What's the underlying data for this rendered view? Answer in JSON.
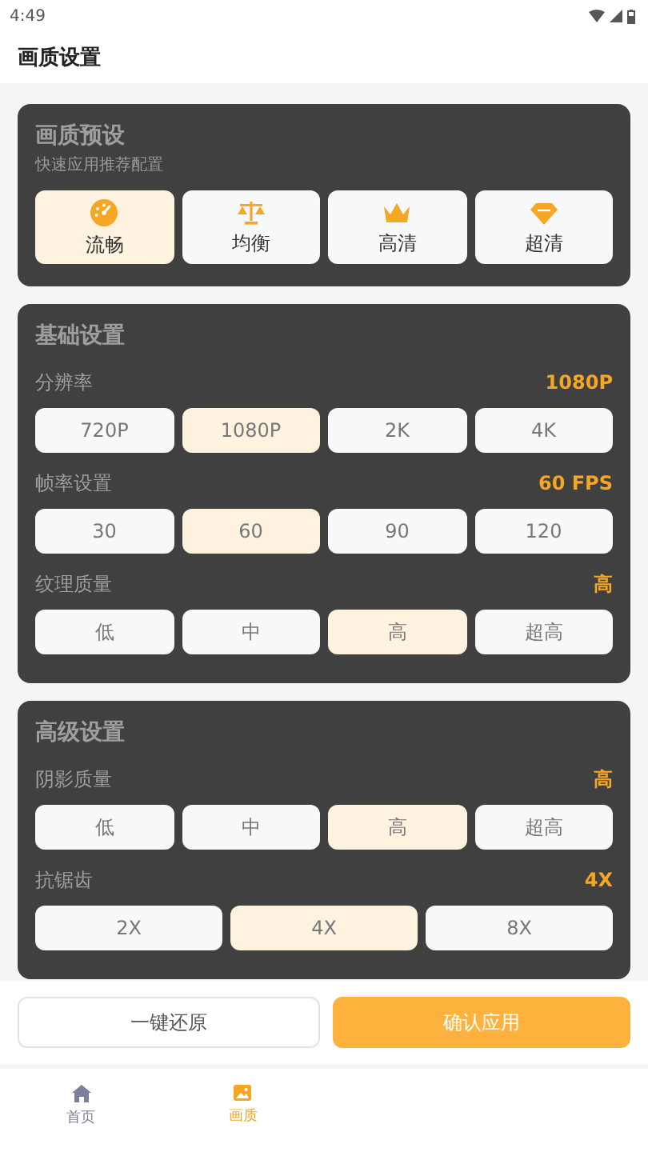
{
  "status_bar": {
    "time": "4:49"
  },
  "header": {
    "title": "画质设置"
  },
  "presets": {
    "title": "画质预设",
    "subtitle": "快速应用推荐配置",
    "options": [
      {
        "label": "流畅",
        "selected": true
      },
      {
        "label": "均衡",
        "selected": false
      },
      {
        "label": "高清",
        "selected": false
      },
      {
        "label": "超清",
        "selected": false
      }
    ]
  },
  "sections": [
    {
      "title": "基础设置",
      "settings": [
        {
          "label": "分辨率",
          "value": "1080P",
          "options": [
            {
              "label": "720P",
              "selected": false
            },
            {
              "label": "1080P",
              "selected": true
            },
            {
              "label": "2K",
              "selected": false
            },
            {
              "label": "4K",
              "selected": false
            }
          ]
        },
        {
          "label": "帧率设置",
          "value": "60 FPS",
          "options": [
            {
              "label": "30",
              "selected": false
            },
            {
              "label": "60",
              "selected": true
            },
            {
              "label": "90",
              "selected": false
            },
            {
              "label": "120",
              "selected": false
            }
          ]
        },
        {
          "label": "纹理质量",
          "value": "高",
          "options": [
            {
              "label": "低",
              "selected": false
            },
            {
              "label": "中",
              "selected": false
            },
            {
              "label": "高",
              "selected": true
            },
            {
              "label": "超高",
              "selected": false
            }
          ]
        }
      ]
    },
    {
      "title": "高级设置",
      "settings": [
        {
          "label": "阴影质量",
          "value": "高",
          "options": [
            {
              "label": "低",
              "selected": false
            },
            {
              "label": "中",
              "selected": false
            },
            {
              "label": "高",
              "selected": true
            },
            {
              "label": "超高",
              "selected": false
            }
          ]
        },
        {
          "label": "抗锯齿",
          "value": "4X",
          "options": [
            {
              "label": "2X",
              "selected": false
            },
            {
              "label": "4X",
              "selected": true
            },
            {
              "label": "8X",
              "selected": false
            }
          ]
        }
      ]
    }
  ],
  "actions": [
    {
      "label": "一键还原",
      "kind": "secondary"
    },
    {
      "label": "确认应用",
      "kind": "primary"
    }
  ],
  "nav": [
    {
      "label": "首页",
      "selected": false
    },
    {
      "label": "画质",
      "selected": true
    }
  ]
}
